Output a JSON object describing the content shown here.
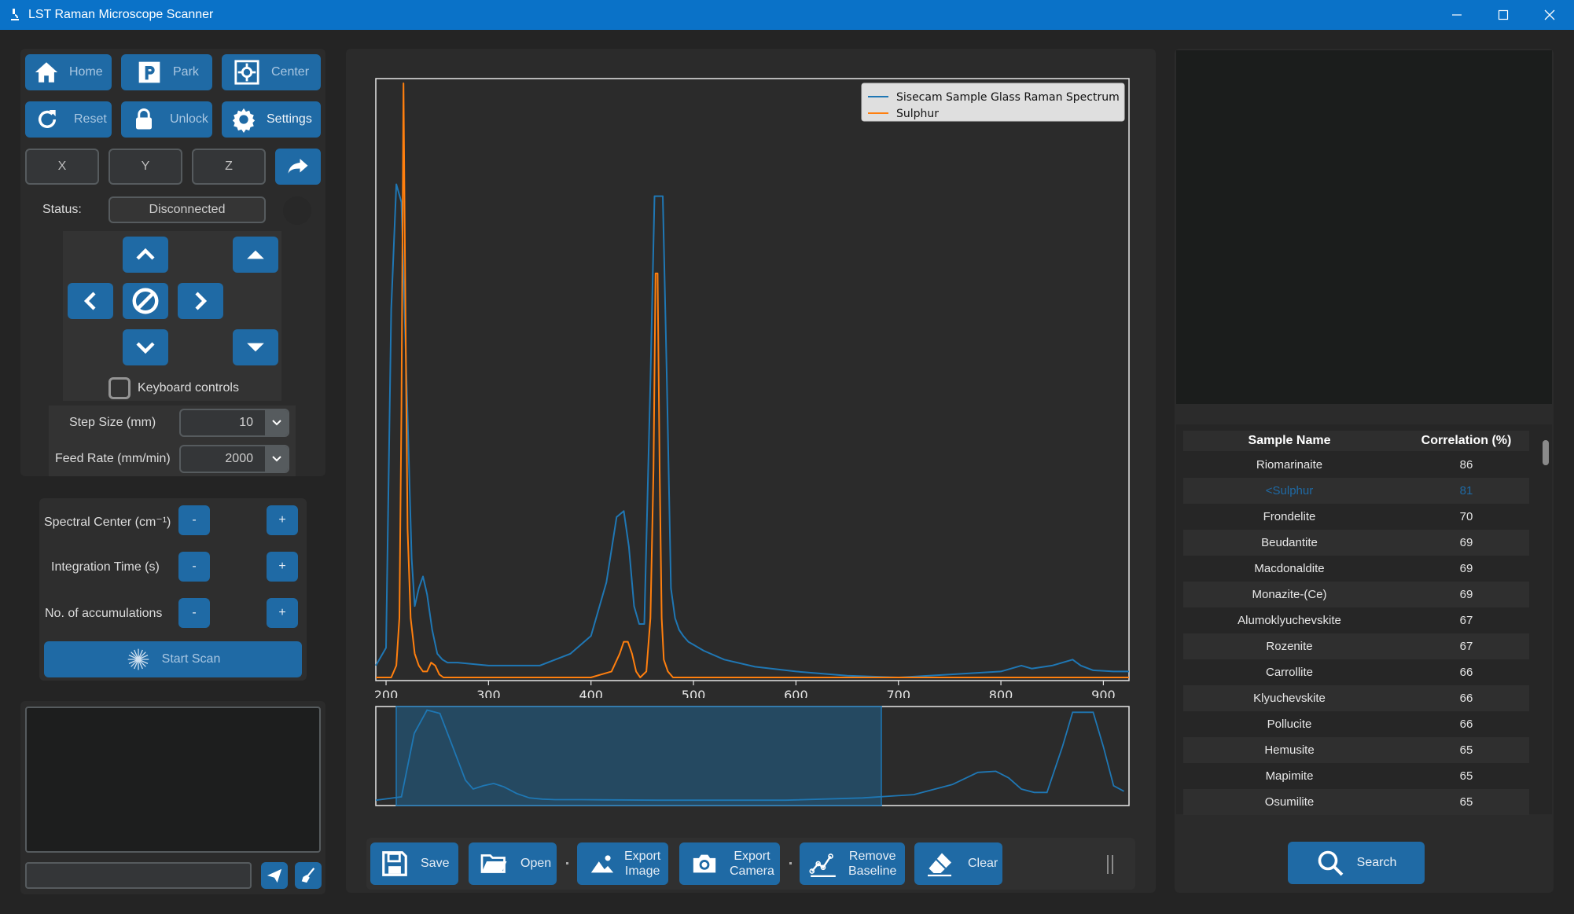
{
  "window": {
    "title": "LST Raman Microscope Scanner"
  },
  "motion": {
    "home": "Home",
    "park": "Park",
    "center": "Center",
    "reset": "Reset",
    "unlock": "Unlock",
    "settings": "Settings",
    "x_placeholder": "X",
    "y_placeholder": "Y",
    "z_placeholder": "Z",
    "status_label": "Status:",
    "status_value": "Disconnected",
    "keyboard_controls": "Keyboard controls",
    "step_size_label": "Step Size (mm)",
    "step_size_value": "10",
    "feed_rate_label": "Feed Rate (mm/min)",
    "feed_rate_value": "2000"
  },
  "spectrometer": {
    "spectral_center_label": "Spectral Center (cm⁻¹)",
    "integration_time_label": "Integration Time (s)",
    "accumulations_label": "No. of accumulations",
    "minus": "-",
    "plus": "+",
    "start_scan": "Start Scan"
  },
  "chart_data": {
    "type": "line",
    "xlim": [
      190,
      925
    ],
    "xticks": [
      "200",
      "300",
      "400",
      "500",
      "600",
      "700",
      "800",
      "900"
    ],
    "legend_position": "top-right",
    "series": [
      {
        "name": "Sisecam Sample Glass Raman Spectrum",
        "color": "#1f77b4",
        "x": [
          190,
          200,
          205,
          210,
          215,
          220,
          225,
          228,
          232,
          236,
          240,
          245,
          250,
          255,
          260,
          270,
          300,
          330,
          350,
          380,
          400,
          415,
          425,
          432,
          437,
          442,
          447,
          452,
          458,
          462,
          466,
          470,
          474,
          478,
          482,
          486,
          490,
          495,
          500,
          510,
          530,
          560,
          600,
          650,
          700,
          750,
          800,
          820,
          830,
          850,
          870,
          878,
          890,
          910,
          925
        ],
        "y": [
          0.02,
          0.05,
          0.62,
          0.83,
          0.8,
          0.5,
          0.2,
          0.12,
          0.15,
          0.17,
          0.14,
          0.08,
          0.04,
          0.03,
          0.025,
          0.025,
          0.02,
          0.02,
          0.02,
          0.04,
          0.07,
          0.16,
          0.27,
          0.28,
          0.22,
          0.12,
          0.09,
          0.09,
          0.5,
          0.81,
          0.81,
          0.81,
          0.5,
          0.15,
          0.1,
          0.08,
          0.07,
          0.06,
          0.055,
          0.045,
          0.03,
          0.018,
          0.01,
          0.003,
          0.0,
          0.005,
          0.01,
          0.02,
          0.015,
          0.02,
          0.03,
          0.02,
          0.012,
          0.01,
          0.01
        ]
      },
      {
        "name": "Sulphur",
        "color": "#ff7f0e",
        "x": [
          190,
          205,
          210,
          213,
          215,
          217,
          219,
          221,
          224,
          228,
          232,
          236,
          240,
          244,
          248,
          252,
          256,
          300,
          400,
          420,
          428,
          432,
          436,
          440,
          444,
          448,
          454,
          458,
          461,
          463,
          465,
          467,
          469,
          471,
          475,
          480,
          490,
          500,
          600,
          700,
          800,
          900,
          925
        ],
        "y": [
          0,
          0,
          0.02,
          0.1,
          0.45,
          1.0,
          0.6,
          0.25,
          0.1,
          0.04,
          0.02,
          0.01,
          0.01,
          0.025,
          0.02,
          0.005,
          0,
          0,
          0,
          0.01,
          0.04,
          0.06,
          0.06,
          0.04,
          0.01,
          0,
          0.01,
          0.1,
          0.35,
          0.68,
          0.68,
          0.35,
          0.1,
          0.03,
          0.01,
          0,
          0,
          0,
          0,
          0,
          0,
          0,
          0
        ]
      }
    ]
  },
  "plot_toolbar": {
    "save": "Save",
    "open": "Open",
    "export_image_1": "Export",
    "export_image_2": "Image",
    "export_camera_1": "Export",
    "export_camera_2": "Camera",
    "remove_baseline_1": "Remove",
    "remove_baseline_2": "Baseline",
    "clear": "Clear"
  },
  "results": {
    "col_name": "Sample Name",
    "col_corr": "Correlation (%)",
    "rows": [
      {
        "name": "Riomarinaite",
        "corr": "86"
      },
      {
        "name": "<Sulphur",
        "corr": "81"
      },
      {
        "name": "Frondelite",
        "corr": "70"
      },
      {
        "name": "Beudantite",
        "corr": "69"
      },
      {
        "name": "Macdonaldite",
        "corr": "69"
      },
      {
        "name": "Monazite-(Ce)",
        "corr": "69"
      },
      {
        "name": "Alumoklyuchevskite",
        "corr": "67"
      },
      {
        "name": "Rozenite",
        "corr": "67"
      },
      {
        "name": "Carrollite",
        "corr": "66"
      },
      {
        "name": "Klyuchevskite",
        "corr": "66"
      },
      {
        "name": "Pollucite",
        "corr": "66"
      },
      {
        "name": "Hemusite",
        "corr": "65"
      },
      {
        "name": "Mapimite",
        "corr": "65"
      },
      {
        "name": "Osumilite",
        "corr": "65"
      }
    ],
    "search": "Search"
  }
}
